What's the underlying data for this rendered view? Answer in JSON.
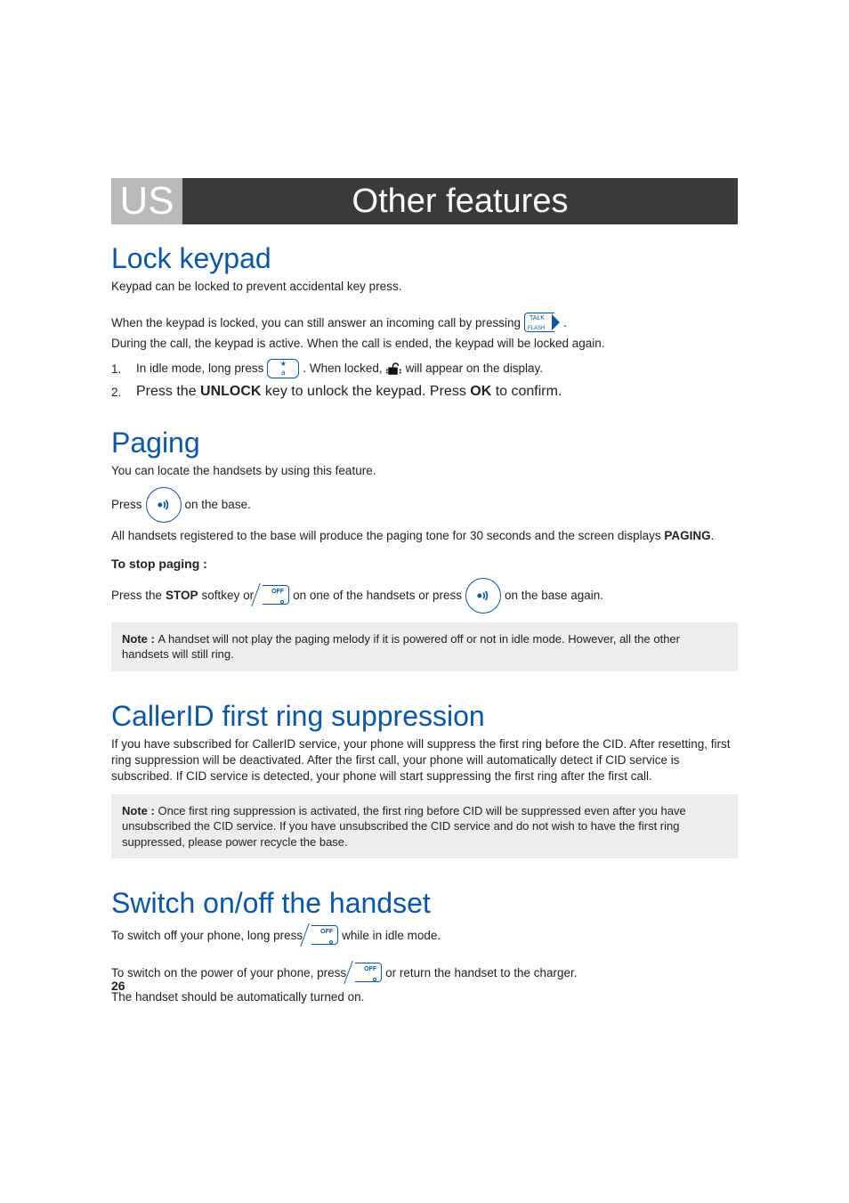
{
  "header": {
    "lang": "US",
    "title": "Other features"
  },
  "lock": {
    "title": "Lock keypad",
    "intro": "Keypad can be locked to prevent accidental key press.",
    "p1a": "When the keypad is locked, you can still answer an incoming call by pressing ",
    "p1b": ".",
    "p2": "During the call, the keypad is active. When the call is ended, the keypad will be locked again.",
    "step1_num": "1.",
    "step1_a": "In idle mode, long press ",
    "step1_b": ". When locked, ",
    "step1_c": " will appear on the display.",
    "step2_num": "2.",
    "step2_a": "Press the ",
    "step2_unlock": "UNLOCK",
    "step2_b": " key to unlock the keypad. Press ",
    "step2_ok": "OK",
    "step2_c": " to confirm.",
    "talk_label_top": "TALK",
    "talk_label_bot": "FLASH",
    "star_top": "★",
    "star_bot": "a"
  },
  "paging": {
    "title": "Paging",
    "intro": "You can locate the handsets by using this feature.",
    "press_a": "Press ",
    "press_b": " on the base.",
    "result_a": "All handsets registered to the base will produce the paging tone for 30 seconds and the screen displays ",
    "result_word": "PAGING",
    "result_b": ".",
    "stop_head": "To stop paging :",
    "stop_a": "Press the ",
    "stop_word": "STOP",
    "stop_b": " softkey or ",
    "stop_c": " on one of the handsets or press ",
    "stop_d": " on the base again.",
    "note_label": "Note : ",
    "note_text": "A handset will not play the paging melody if it is powered off or not in idle mode. However, all the other handsets will still ring."
  },
  "cid": {
    "title": "CallerID first ring suppression",
    "body": "If you have subscribed for CallerID service, your phone will suppress the first ring before the CID. After resetting, first ring suppression will be deactivated. After the first call,  your phone will automatically detect if CID service is subscribed. If CID service is detected, your phone will start suppressing the first ring after the first call.",
    "note_label": "Note : ",
    "note_text": "Once first ring suppression is activated, the first ring before CID will be suppressed even after you have unsubscribed the CID service. If you have unsubscribed the CID service and do not wish to have the first ring suppressed, please power recycle the base."
  },
  "switch": {
    "title": "Switch on/off the handset",
    "off_a": "To switch off your phone, long press ",
    "off_b": " while in idle mode.",
    "on_a": "To switch on the power of your phone, press ",
    "on_b": " or return the handset to the charger.",
    "auto": "The handset should be automatically turned on.",
    "off_label": "OFF"
  },
  "page_number": "26"
}
